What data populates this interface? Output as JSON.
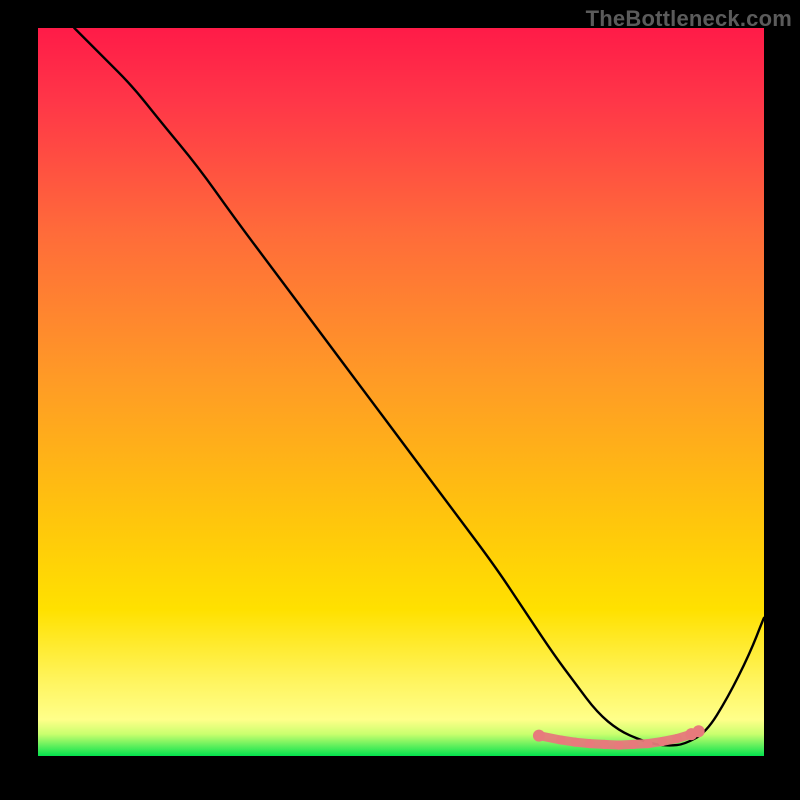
{
  "watermark": "TheBottleneck.com",
  "chart_data": {
    "type": "line",
    "title": "",
    "xlabel": "",
    "ylabel": "",
    "xlim": [
      0,
      100
    ],
    "ylim": [
      0,
      100
    ],
    "grid": false,
    "legend": false,
    "background_gradient": {
      "top": "#ff1b48",
      "mid": "#ffcd00",
      "bottom_band": "#ffff8a",
      "bottom_edge": "#04e24e"
    },
    "series": [
      {
        "name": "bottleneck-curve",
        "color": "#000000",
        "x": [
          5,
          9,
          13,
          17,
          22,
          27,
          33,
          39,
          45,
          51,
          57,
          63,
          67,
          71,
          74,
          77,
          80,
          83,
          85,
          87,
          89,
          92,
          95,
          98,
          100
        ],
        "y": [
          100,
          96,
          92,
          87,
          81,
          74,
          66,
          58,
          50,
          42,
          34,
          26,
          20,
          14,
          10,
          6,
          3.5,
          2.2,
          1.6,
          1.4,
          1.6,
          3.2,
          8,
          14,
          19
        ]
      },
      {
        "name": "optimal-markers",
        "color": "#e77a7c",
        "type": "scatter",
        "x": [
          69,
          72,
          74,
          76,
          78,
          80,
          82,
          84,
          86,
          88,
          90,
          91
        ],
        "y": [
          2.8,
          2.2,
          1.9,
          1.7,
          1.6,
          1.5,
          1.6,
          1.7,
          2.0,
          2.4,
          3.0,
          3.4
        ]
      }
    ]
  }
}
